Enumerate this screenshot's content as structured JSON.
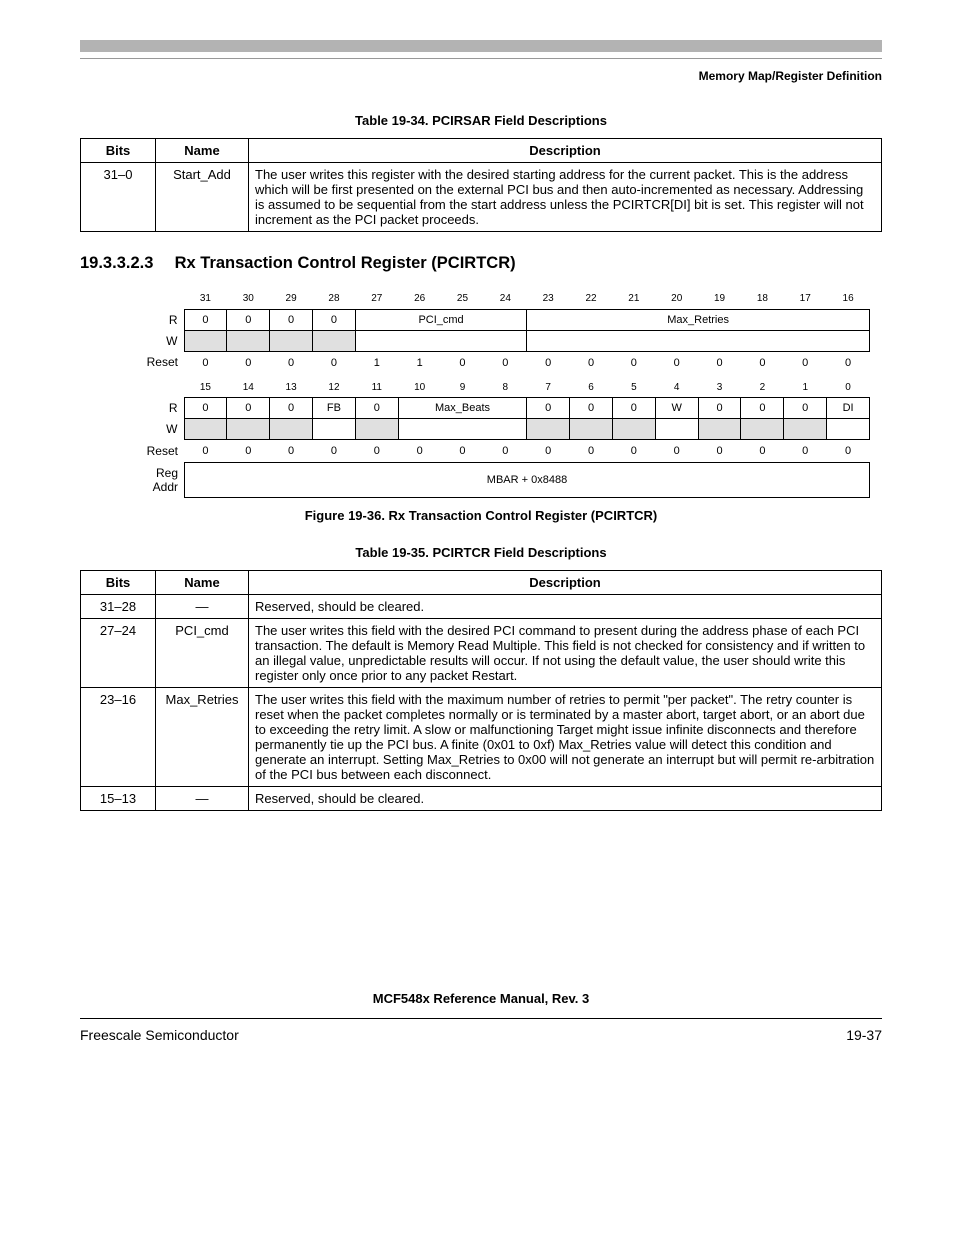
{
  "sectionLabel": "Memory Map/Register Definition",
  "table34": {
    "caption": "Table 19-34. PCIRSAR Field Descriptions",
    "headers": [
      "Bits",
      "Name",
      "Description"
    ],
    "rows": [
      {
        "bits": "31–0",
        "name": "Start_Add",
        "desc": "The user writes this register with the desired starting address for the current packet. This is the address which will be first presented on the external PCI bus and then auto-incremented as necessary. Addressing is assumed to be sequential from the start address unless the PCIRTCR[DI] bit is set. This register will not increment as the PCI packet proceeds."
      }
    ]
  },
  "heading": {
    "num": "19.3.3.2.3",
    "title": "Rx Transaction Control Register (PCIRTCR)"
  },
  "reg": {
    "top": {
      "bitnums": [
        "31",
        "30",
        "29",
        "28",
        "27",
        "26",
        "25",
        "24",
        "23",
        "22",
        "21",
        "20",
        "19",
        "18",
        "17",
        "16"
      ],
      "rLabel": "R",
      "wLabel": "W",
      "resetLabel": "Reset",
      "rCells": [
        {
          "t": "0",
          "span": 1,
          "gray": false
        },
        {
          "t": "0",
          "span": 1,
          "gray": false
        },
        {
          "t": "0",
          "span": 1,
          "gray": false
        },
        {
          "t": "0",
          "span": 1,
          "gray": false
        },
        {
          "t": "PCI_cmd",
          "span": 4,
          "gray": false
        },
        {
          "t": "Max_Retries",
          "span": 8,
          "gray": false
        }
      ],
      "wCells": [
        {
          "t": "",
          "span": 1,
          "gray": true
        },
        {
          "t": "",
          "span": 1,
          "gray": true
        },
        {
          "t": "",
          "span": 1,
          "gray": true
        },
        {
          "t": "",
          "span": 1,
          "gray": true
        },
        {
          "t": "",
          "span": 4,
          "gray": false
        },
        {
          "t": "",
          "span": 8,
          "gray": false
        }
      ],
      "reset": [
        "0",
        "0",
        "0",
        "0",
        "1",
        "1",
        "0",
        "0",
        "0",
        "0",
        "0",
        "0",
        "0",
        "0",
        "0",
        "0"
      ]
    },
    "bottom": {
      "bitnums": [
        "15",
        "14",
        "13",
        "12",
        "11",
        "10",
        "9",
        "8",
        "7",
        "6",
        "5",
        "4",
        "3",
        "2",
        "1",
        "0"
      ],
      "rCells": [
        {
          "t": "0",
          "span": 1,
          "gray": false
        },
        {
          "t": "0",
          "span": 1,
          "gray": false
        },
        {
          "t": "0",
          "span": 1,
          "gray": false
        },
        {
          "t": "FB",
          "span": 1,
          "gray": false
        },
        {
          "t": "0",
          "span": 1,
          "gray": false
        },
        {
          "t": "Max_Beats",
          "span": 3,
          "gray": false
        },
        {
          "t": "0",
          "span": 1,
          "gray": false
        },
        {
          "t": "0",
          "span": 1,
          "gray": false
        },
        {
          "t": "0",
          "span": 1,
          "gray": false
        },
        {
          "t": "W",
          "span": 1,
          "gray": false
        },
        {
          "t": "0",
          "span": 1,
          "gray": false
        },
        {
          "t": "0",
          "span": 1,
          "gray": false
        },
        {
          "t": "0",
          "span": 1,
          "gray": false
        },
        {
          "t": "DI",
          "span": 1,
          "gray": false
        }
      ],
      "wCells": [
        {
          "t": "",
          "span": 1,
          "gray": true
        },
        {
          "t": "",
          "span": 1,
          "gray": true
        },
        {
          "t": "",
          "span": 1,
          "gray": true
        },
        {
          "t": "",
          "span": 1,
          "gray": false
        },
        {
          "t": "",
          "span": 1,
          "gray": true
        },
        {
          "t": "",
          "span": 3,
          "gray": false
        },
        {
          "t": "",
          "span": 1,
          "gray": true
        },
        {
          "t": "",
          "span": 1,
          "gray": true
        },
        {
          "t": "",
          "span": 1,
          "gray": true
        },
        {
          "t": "",
          "span": 1,
          "gray": false
        },
        {
          "t": "",
          "span": 1,
          "gray": true
        },
        {
          "t": "",
          "span": 1,
          "gray": true
        },
        {
          "t": "",
          "span": 1,
          "gray": true
        },
        {
          "t": "",
          "span": 1,
          "gray": false
        }
      ],
      "reset": [
        "0",
        "0",
        "0",
        "0",
        "0",
        "0",
        "0",
        "0",
        "0",
        "0",
        "0",
        "0",
        "0",
        "0",
        "0",
        "0"
      ]
    },
    "regAddrLabel1": "Reg",
    "regAddrLabel2": "Addr",
    "regAddr": "MBAR + 0x8488"
  },
  "figCaption": "Figure 19-36. Rx Transaction Control Register (PCIRTCR)",
  "table35": {
    "caption": "Table 19-35. PCIRTCR Field Descriptions",
    "headers": [
      "Bits",
      "Name",
      "Description"
    ],
    "rows": [
      {
        "bits": "31–28",
        "name": "—",
        "desc": "Reserved, should be cleared."
      },
      {
        "bits": "27–24",
        "name": "PCI_cmd",
        "desc": "The user writes this field with the desired PCI command to present during the address phase of each PCI transaction. The default is Memory Read Multiple. This field is not checked for consistency and if written to an illegal value, unpredictable results will occur. If not using the default value, the user should write this register only once prior to any packet Restart."
      },
      {
        "bits": "23–16",
        "name": "Max_Retries",
        "desc": "The user writes this field with the maximum number of retries to permit \"per packet\". The retry counter is reset when the packet completes normally or is terminated by a master abort, target abort, or an abort due to exceeding the retry limit. A slow or malfunctioning Target might issue infinite disconnects and therefore permanently tie up the PCI bus. A finite (0x01 to 0xf) Max_Retries value will detect this condition and generate an interrupt. Setting Max_Retries to 0x00 will not generate an interrupt but will permit re-arbitration of the PCI bus between each disconnect."
      },
      {
        "bits": "15–13",
        "name": "—",
        "desc": "Reserved, should be cleared."
      }
    ]
  },
  "footerTitle": "MCF548x Reference Manual, Rev. 3",
  "footerLeft": "Freescale Semiconductor",
  "footerRight": "19-37"
}
